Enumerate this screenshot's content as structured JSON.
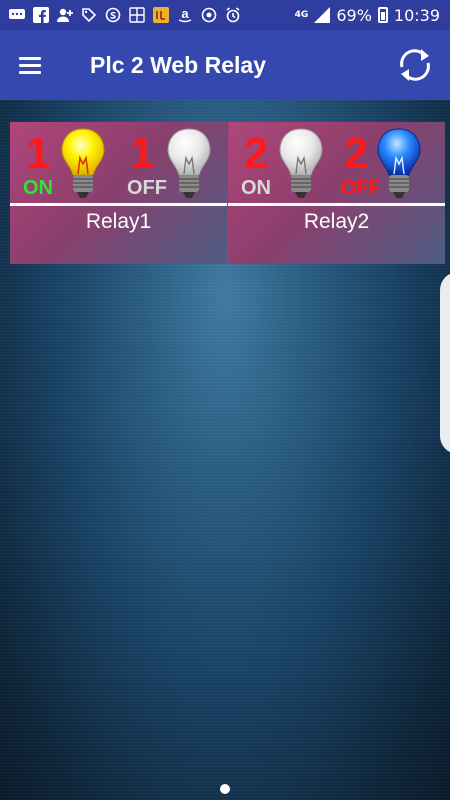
{
  "status_bar": {
    "battery": "69%",
    "network": "4G",
    "time": "10:39"
  },
  "app_bar": {
    "title": "Plc 2 Web Relay"
  },
  "relays": [
    {
      "label": "Relay1",
      "number": "1",
      "on_text": "ON",
      "off_text": "OFF",
      "active": "on"
    },
    {
      "label": "Relay2",
      "number": "2",
      "on_text": "ON",
      "off_text": "OFF",
      "active": "off"
    }
  ],
  "colors": {
    "status_bar": "#2f3e9e",
    "app_bar": "#3448b0",
    "number": "#ff1a1a",
    "active_on": "#2ee62e",
    "active_off": "#ff1a1a",
    "inactive": "#d8d8d8"
  }
}
